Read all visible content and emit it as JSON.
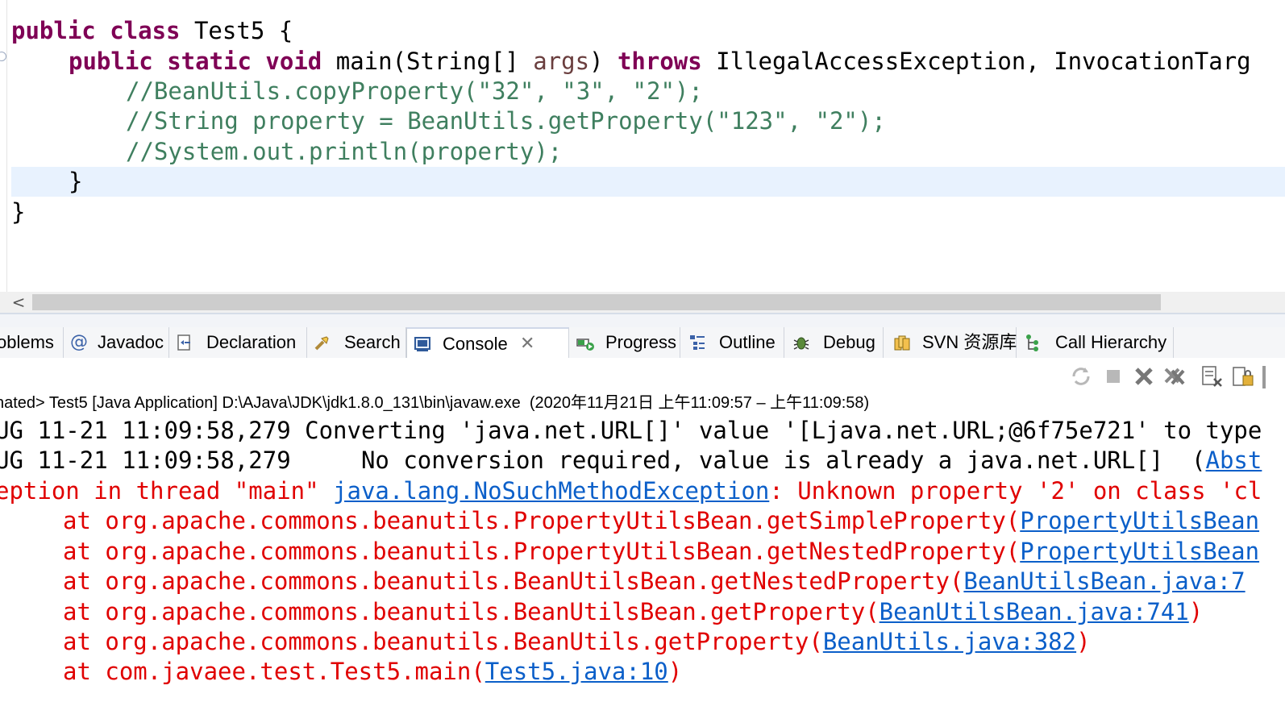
{
  "editor": {
    "line1": {
      "kw": "public class",
      "rest": " Test5 {"
    },
    "line2": {
      "kw": "public static void",
      "mid": " main(String[] ",
      "param": "args",
      "mid2": ") ",
      "kw2": "throws",
      "rest": " IllegalAccessException, InvocationTarg"
    },
    "line3": "//BeanUtils.copyProperty(\"32\", \"3\", \"2\");",
    "line4": "//String property = BeanUtils.getProperty(\"123\", \"2\");",
    "line5": "//System.out.println(property);",
    "line6": "}",
    "line7": "}"
  },
  "scrollbar": {
    "left_arrow": "<"
  },
  "tabs": [
    {
      "label": "oblems"
    },
    {
      "label": "Javadoc"
    },
    {
      "label": "Declaration"
    },
    {
      "label": "Search"
    },
    {
      "label": "Console",
      "close": "✕"
    },
    {
      "label": "Progress"
    },
    {
      "label": "Outline"
    },
    {
      "label": "Debug"
    },
    {
      "label": "SVN 资源库"
    },
    {
      "label": "Call Hierarchy"
    }
  ],
  "console": {
    "header": "nated> Test5 [Java Application] D:\\AJava\\JDK\\jdk1.8.0_131\\bin\\javaw.exe  (2020年11月21日 上午11:09:57 – 上午11:09:58)",
    "log1": "UG 11-21 11:09:58,279 Converting 'java.net.URL[]' value '[Ljava.net.URL;@6f75e721' to type",
    "log2": {
      "text": "UG 11-21 11:09:58,279     No conversion required, value is already a java.net.URL[]  (",
      "link": "Abst"
    },
    "exception": {
      "prefix": "eption in thread \"main\" ",
      "link": "java.lang.NoSuchMethodException",
      "suffix": ": Unknown property '2' on class 'cl"
    },
    "stack": [
      {
        "text": "\tat org.apache.commons.beanutils.PropertyUtilsBean.getSimpleProperty(",
        "link": "PropertyUtilsBean",
        "end": ""
      },
      {
        "text": "\tat org.apache.commons.beanutils.PropertyUtilsBean.getNestedProperty(",
        "link": "PropertyUtilsBean",
        "end": ""
      },
      {
        "text": "\tat org.apache.commons.beanutils.BeanUtilsBean.getNestedProperty(",
        "link": "BeanUtilsBean.java:7",
        "end": ""
      },
      {
        "text": "\tat org.apache.commons.beanutils.BeanUtilsBean.getProperty(",
        "link": "BeanUtilsBean.java:741",
        "end": ")"
      },
      {
        "text": "\tat org.apache.commons.beanutils.BeanUtils.getProperty(",
        "link": "BeanUtils.java:382",
        "end": ")"
      },
      {
        "text": "\tat com.javaee.test.Test5.main(",
        "link": "Test5.java:10",
        "end": ")"
      }
    ]
  },
  "colors": {
    "keyword": "#7f0055",
    "comment": "#3f7f5f",
    "error": "#e00000",
    "link": "#0b5fc9",
    "current_line": "#e8f2fe"
  }
}
